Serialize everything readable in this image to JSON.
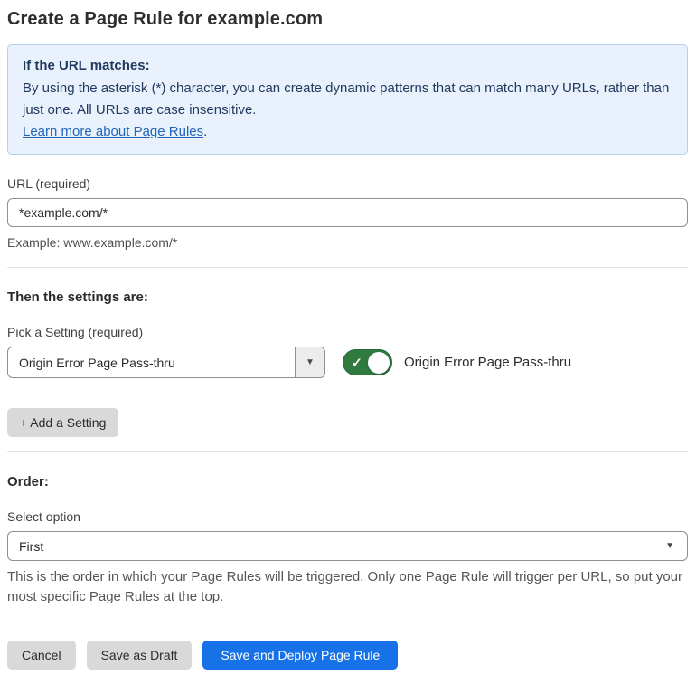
{
  "page": {
    "title": "Create a Page Rule for example.com"
  },
  "info_box": {
    "heading": "If the URL matches:",
    "body": "By using the asterisk (*) character, you can create dynamic patterns that can match many URLs, rather than just one. All URLs are case insensitive.",
    "link_label": "Learn more about Page Rules",
    "link_suffix": "."
  },
  "url_field": {
    "label": "URL (required)",
    "value": "*example.com/*",
    "helper": "Example: www.example.com/*"
  },
  "settings": {
    "heading": "Then the settings are:",
    "picker_label": "Pick a Setting (required)",
    "selected_setting": "Origin Error Page Pass-thru",
    "dropdown_caret_icon": "▼",
    "toggle_state": "on",
    "toggle_check_icon": "✓",
    "toggle_label": "Origin Error Page Pass-thru",
    "add_button_label": "+ Add a Setting"
  },
  "order": {
    "heading": "Order:",
    "select_label": "Select option",
    "selected_option": "First",
    "select_caret_icon": "▼",
    "helper": "This is the order in which your Page Rules will be triggered. Only one Page Rule will trigger per URL, so put your most specific Page Rules at the top."
  },
  "footer": {
    "cancel_label": "Cancel",
    "save_draft_label": "Save as Draft",
    "save_deploy_label": "Save and Deploy Page Rule"
  },
  "colors": {
    "accent_blue": "#1672e6",
    "info_background": "#e9f2fc",
    "info_border": "#b3cfe9",
    "info_text": "#22395f",
    "link_blue": "#2264ba",
    "toggle_green_on": "#2f7b3f",
    "neutral_button_gray": "#d9d9d9"
  }
}
